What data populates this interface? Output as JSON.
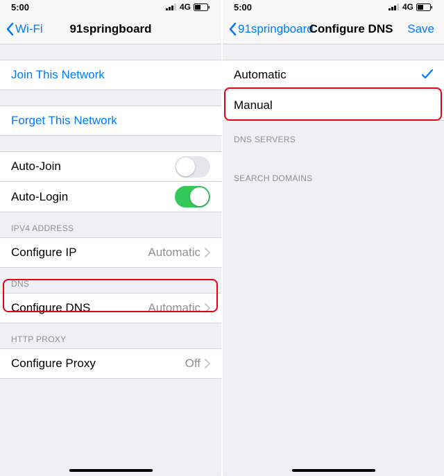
{
  "status": {
    "time": "5:00",
    "network": "4G"
  },
  "left": {
    "nav": {
      "back": "Wi-Fi",
      "title": "91springboard"
    },
    "actions": {
      "join": "Join This Network",
      "forget": "Forget This Network"
    },
    "rows": {
      "autojoin": "Auto-Join",
      "autologin": "Auto-Login"
    },
    "sections": {
      "ipv4": "IPV4 ADDRESS",
      "dns": "DNS",
      "proxy": "HTTP PROXY"
    },
    "items": {
      "configure_ip": {
        "label": "Configure IP",
        "value": "Automatic"
      },
      "configure_dns": {
        "label": "Configure DNS",
        "value": "Automatic"
      },
      "configure_proxy": {
        "label": "Configure Proxy",
        "value": "Off"
      }
    }
  },
  "right": {
    "nav": {
      "back": "91springboard",
      "title": "Configure DNS",
      "save": "Save"
    },
    "options": {
      "automatic": "Automatic",
      "manual": "Manual"
    },
    "sections": {
      "dns_servers": "DNS SERVERS",
      "search_domains": "SEARCH DOMAINS"
    }
  }
}
